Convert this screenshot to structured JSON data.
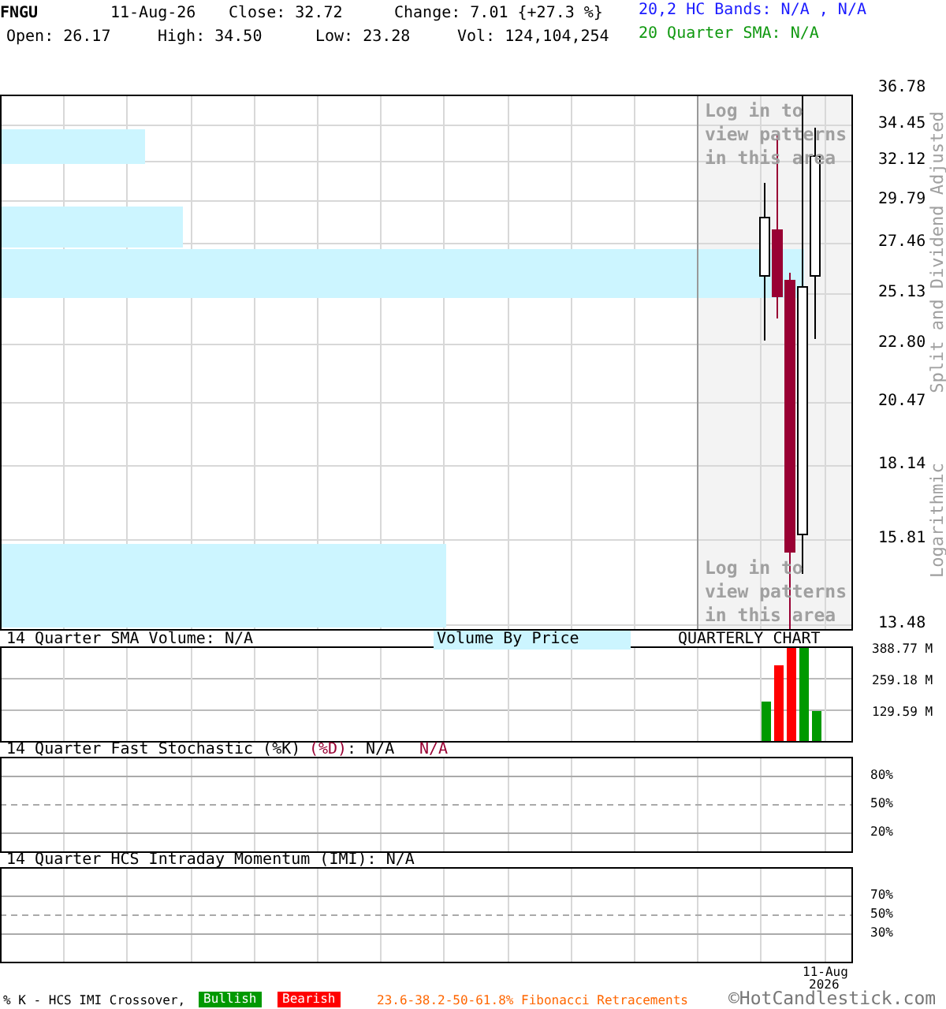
{
  "header": {
    "symbol": "FNGU",
    "date": "11-Aug-26",
    "close": "Close: 32.72",
    "change": "Change: 7.01 {+27.3 %}",
    "open": "Open: 26.17",
    "high": "High: 34.50",
    "low": "Low: 23.28",
    "volume": "Vol: 124,104,254",
    "bands": "20,2 HC Bands: N/A , N/A",
    "sma": "20 Quarter SMA: N/A"
  },
  "price_chart": {
    "y_ticks": [
      "36.78",
      "34.45",
      "32.12",
      "29.79",
      "27.46",
      "25.13",
      "22.80",
      "20.47",
      "18.14",
      "15.81",
      "13.48"
    ],
    "login_notes": [
      "Log in to view patterns in this area",
      "Log in to view patterns in this area"
    ],
    "axis_notes": [
      "Split and Dividend Adjusted",
      "Logarithmic"
    ]
  },
  "volume_panel": {
    "title": "14 Quarter SMA Volume: N/A",
    "vbp_label": "Volume By Price",
    "period_label": "QUARTERLY CHART",
    "y_ticks": [
      "388.77 M",
      "259.18 M",
      "129.59 M"
    ]
  },
  "stochastic_panel": {
    "title": "14 Quarter Fast Stochastic (%K)",
    "d_label": "(%D)",
    "k_value": ": N/A",
    "d_value": "N/A",
    "y_ticks": [
      "80%",
      "50%",
      "20%"
    ]
  },
  "imi_panel": {
    "title": "14 Quarter HCS Intraday Momentum (IMI): N/A",
    "y_ticks": [
      "70%",
      "50%",
      "30%"
    ]
  },
  "x_label": [
    "11-Aug",
    "2026"
  ],
  "legend": {
    "crossover": "% K - HCS IMI Crossover,",
    "bullish": "Bullish",
    "bearish": "Bearish",
    "fibonacci": "23.6-38.2-50-61.8% Fibonacci Retracements"
  },
  "copyright": "©HotCandlestick.com"
}
